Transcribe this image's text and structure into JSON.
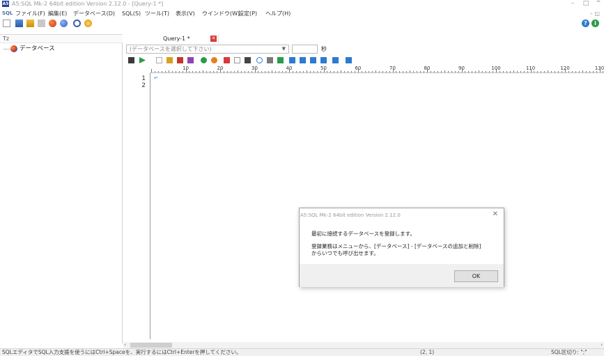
{
  "app": {
    "window_title": "A5:SQL Mk-2 64bit edition Version 2.12.0 - [Query-1 *]",
    "icon_text": "A5"
  },
  "menu": {
    "prefix": "SQL",
    "items": [
      "ファイル(F)",
      "編集(E)",
      "データベース(D)",
      "SQL(S)",
      "ツール(T)",
      "表示(V)",
      "ウインドウ(W)",
      "設定(P)",
      "ヘルプ(H)"
    ]
  },
  "left_pane": {
    "header_icon": "Tz",
    "tree_root": "データベース"
  },
  "editor": {
    "tab_label": "Query-1 *",
    "db_select_placeholder": "(データベースを選択して下さい)",
    "seconds_unit": "秒",
    "line_numbers": [
      "1",
      "2"
    ],
    "ruler_labels": [
      "10",
      "20",
      "30",
      "40",
      "50",
      "60",
      "70",
      "80",
      "90",
      "100",
      "110",
      "120",
      "130"
    ]
  },
  "status": {
    "hint": "SQLエディタでSQL入力支援を使うにはCtrl+Spaceを、実行するにはCtrl+Enterを押してください。",
    "position": "(2, 1)",
    "delimiter": "SQL区切り: \";\""
  },
  "dialog": {
    "title": "A5:SQL Mk-2 64bit edition Version 2.12.0",
    "message1": "最初に接続するデータベースを登録します。",
    "message2": "登録業務はメニューから、[データベース] - [データベースの追加と削除] からいつでも呼び出せます。",
    "ok_label": "OK"
  }
}
